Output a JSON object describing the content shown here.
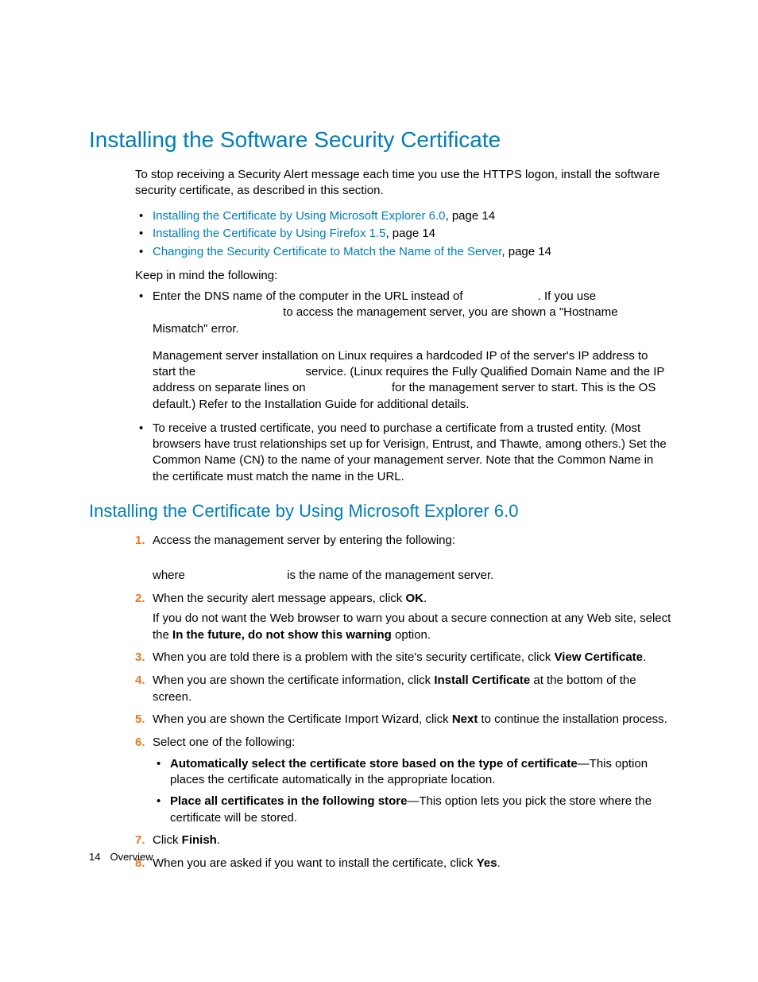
{
  "heading": "Installing the Software Security Certificate",
  "intro": "To stop receiving a Security Alert message each time you use the HTTPS logon, install the software security certificate, as described in this section.",
  "toc": [
    {
      "link": "Installing the Certificate by Using Microsoft Explorer 6.0",
      "suffix": ", page 14"
    },
    {
      "link": "Installing the Certificate by Using Firefox 1.5",
      "suffix": ", page 14"
    },
    {
      "link": "Changing the Security Certificate to Match the Name of the Server",
      "suffix": ", page 14"
    }
  ],
  "keep": "Keep in mind the following:",
  "notes": {
    "n1p1a": "Enter the DNS name of the computer in the URL instead of ",
    "n1p1b": ". If you use ",
    "n1p1c": " to access the management server, you are shown a \"Hostname Mismatch\" error.",
    "n1p2a": "Management server installation on Linux requires a hardcoded IP of the server's IP address to start the ",
    "n1p2b": " service. (Linux requires the Fully Qualified Domain Name and the IP address on separate lines on ",
    "n1p2c": " for the management server to start. This is the OS default.) Refer to the Installation Guide for additional details.",
    "n2": "To receive a trusted certificate, you need to purchase a certificate from a trusted entity. (Most browsers have trust relationships set up for Verisign, Entrust, and Thawte, among others.) Set the Common Name (CN) to the name of your management server. Note that the Common Name in the certificate must match the name in the URL."
  },
  "subheading": "Installing the Certificate by Using Microsoft Explorer 6.0",
  "steps": {
    "s1a": "Access the management server by entering the following:",
    "s1b_pre": "where ",
    "s1b_post": " is the name of the management server.",
    "s2a": "When the security alert message appears, click ",
    "s2a_bold": "OK",
    "s2a_end": ".",
    "s2b_pre": "If you do not want the Web browser to warn you about a secure connection at any Web site, select the ",
    "s2b_bold": "In the future, do not show this warning",
    "s2b_post": " option.",
    "s3_pre": "When you are told there is a problem with the site's security certificate, click ",
    "s3_bold": "View Certificate",
    "s3_end": ".",
    "s4_pre": "When you are shown the certificate information, click ",
    "s4_bold": "Install Certificate",
    "s4_post": " at the bottom of the screen.",
    "s5_pre": "When you are shown the Certificate Import Wizard, click ",
    "s5_bold": "Next",
    "s5_post": " to continue the installation process.",
    "s6": "Select one of the following:",
    "s6a_bold": "Automatically select the certificate store based on the type of certificate",
    "s6a_post": "—This option places the certificate automatically in the appropriate location.",
    "s6b_bold": "Place all certificates in the following store",
    "s6b_post": "—This option lets you pick the store where the certificate will be stored.",
    "s7_pre": "Click ",
    "s7_bold": "Finish",
    "s7_end": ".",
    "s8_pre": "When you are asked if you want to install the certificate, click ",
    "s8_bold": "Yes",
    "s8_end": "."
  },
  "footer": {
    "page": "14",
    "section": "Overview"
  }
}
